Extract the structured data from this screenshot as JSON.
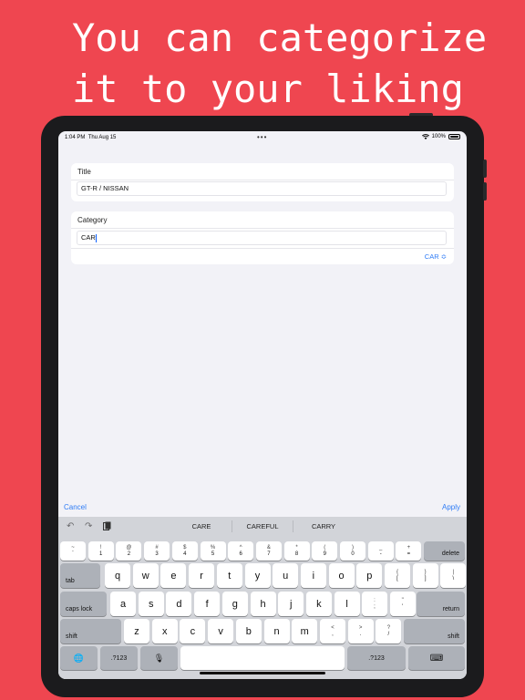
{
  "headline": {
    "line1": "You can categorize",
    "line2": "it to your liking"
  },
  "statusbar": {
    "time": "1:04 PM",
    "date": "Thu Aug 15",
    "dots": "•••",
    "battery_pct": "100%",
    "wifi": "wifi-icon"
  },
  "form": {
    "title_label": "Title",
    "title_value": "GT-R / NISSAN",
    "category_label": "Category",
    "category_value": "CAR",
    "category_select": "CAR ≎"
  },
  "actions": {
    "cancel": "Cancel",
    "apply": "Apply"
  },
  "keyboard": {
    "toolbar": {
      "undo": "↶",
      "redo": "↷",
      "paste": "📋"
    },
    "suggestions": [
      "CARE",
      "CAREFUL",
      "CARRY"
    ],
    "row1": [
      {
        "top": "~",
        "bottom": "`"
      },
      {
        "top": "!",
        "bottom": "1"
      },
      {
        "top": "@",
        "bottom": "2"
      },
      {
        "top": "#",
        "bottom": "3"
      },
      {
        "top": "$",
        "bottom": "4"
      },
      {
        "top": "%",
        "bottom": "5"
      },
      {
        "top": "^",
        "bottom": "6"
      },
      {
        "top": "&",
        "bottom": "7"
      },
      {
        "top": "*",
        "bottom": "8"
      },
      {
        "top": "(",
        "bottom": "9"
      },
      {
        "top": ")",
        "bottom": "0"
      },
      {
        "top": "_",
        "bottom": "-"
      },
      {
        "top": "+",
        "bottom": "="
      }
    ],
    "delete": "delete",
    "tab": "tab",
    "row2": [
      "q",
      "w",
      "e",
      "r",
      "t",
      "y",
      "u",
      "i",
      "o",
      "p"
    ],
    "row2_sym": [
      {
        "top": "{",
        "bottom": "["
      },
      {
        "top": "}",
        "bottom": "]"
      },
      {
        "top": "|",
        "bottom": "\\"
      }
    ],
    "caps_lock": "caps lock",
    "row3": [
      "a",
      "s",
      "d",
      "f",
      "g",
      "h",
      "j",
      "k",
      "l"
    ],
    "row3_sym": [
      {
        "top": ":",
        "bottom": ";"
      },
      {
        "top": "\"",
        "bottom": "'"
      }
    ],
    "return": "return",
    "shift": "shift",
    "row4": [
      "z",
      "x",
      "c",
      "v",
      "b",
      "n",
      "m"
    ],
    "row4_sym": [
      {
        "top": "<",
        "bottom": ","
      },
      {
        "top": ">",
        "bottom": "."
      },
      {
        "top": "?",
        "bottom": "/"
      }
    ],
    "globe": "🌐",
    "num": ".?123",
    "mic": "🎙",
    "hide": "⌨"
  }
}
